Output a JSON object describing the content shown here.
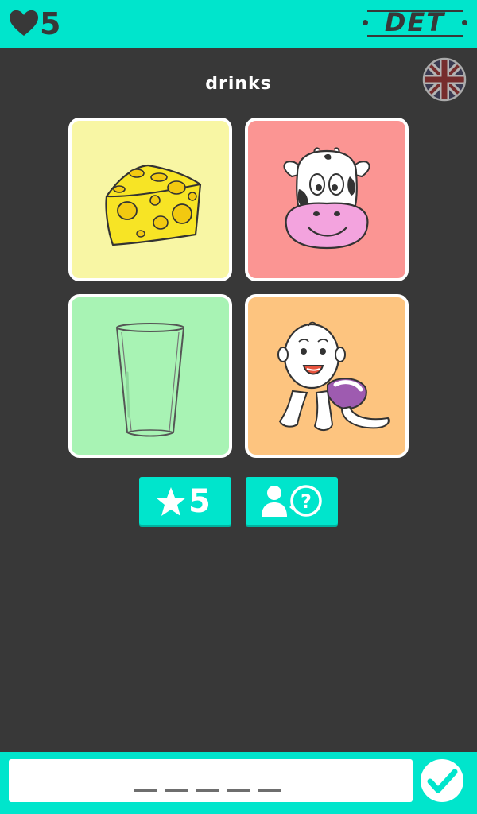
{
  "header": {
    "lives": "5",
    "logo_text": "DET"
  },
  "language_flag": "uk-flag",
  "puzzle": {
    "category": "drinks",
    "cards": [
      {
        "name": "cheese",
        "color": "#F8F6A4"
      },
      {
        "name": "cow",
        "color": "#FB9593"
      },
      {
        "name": "glass",
        "color": "#A8F3B4"
      },
      {
        "name": "baby",
        "color": "#FDC47F"
      }
    ]
  },
  "actions": {
    "stars_count": "5",
    "stars_icon": "star-icon",
    "help_icon": "ask-friend-icon"
  },
  "answer": {
    "letter_slots": 5,
    "submit_icon": "checkmark-icon"
  },
  "colors": {
    "accent": "#00E5CC",
    "background": "#383838"
  }
}
